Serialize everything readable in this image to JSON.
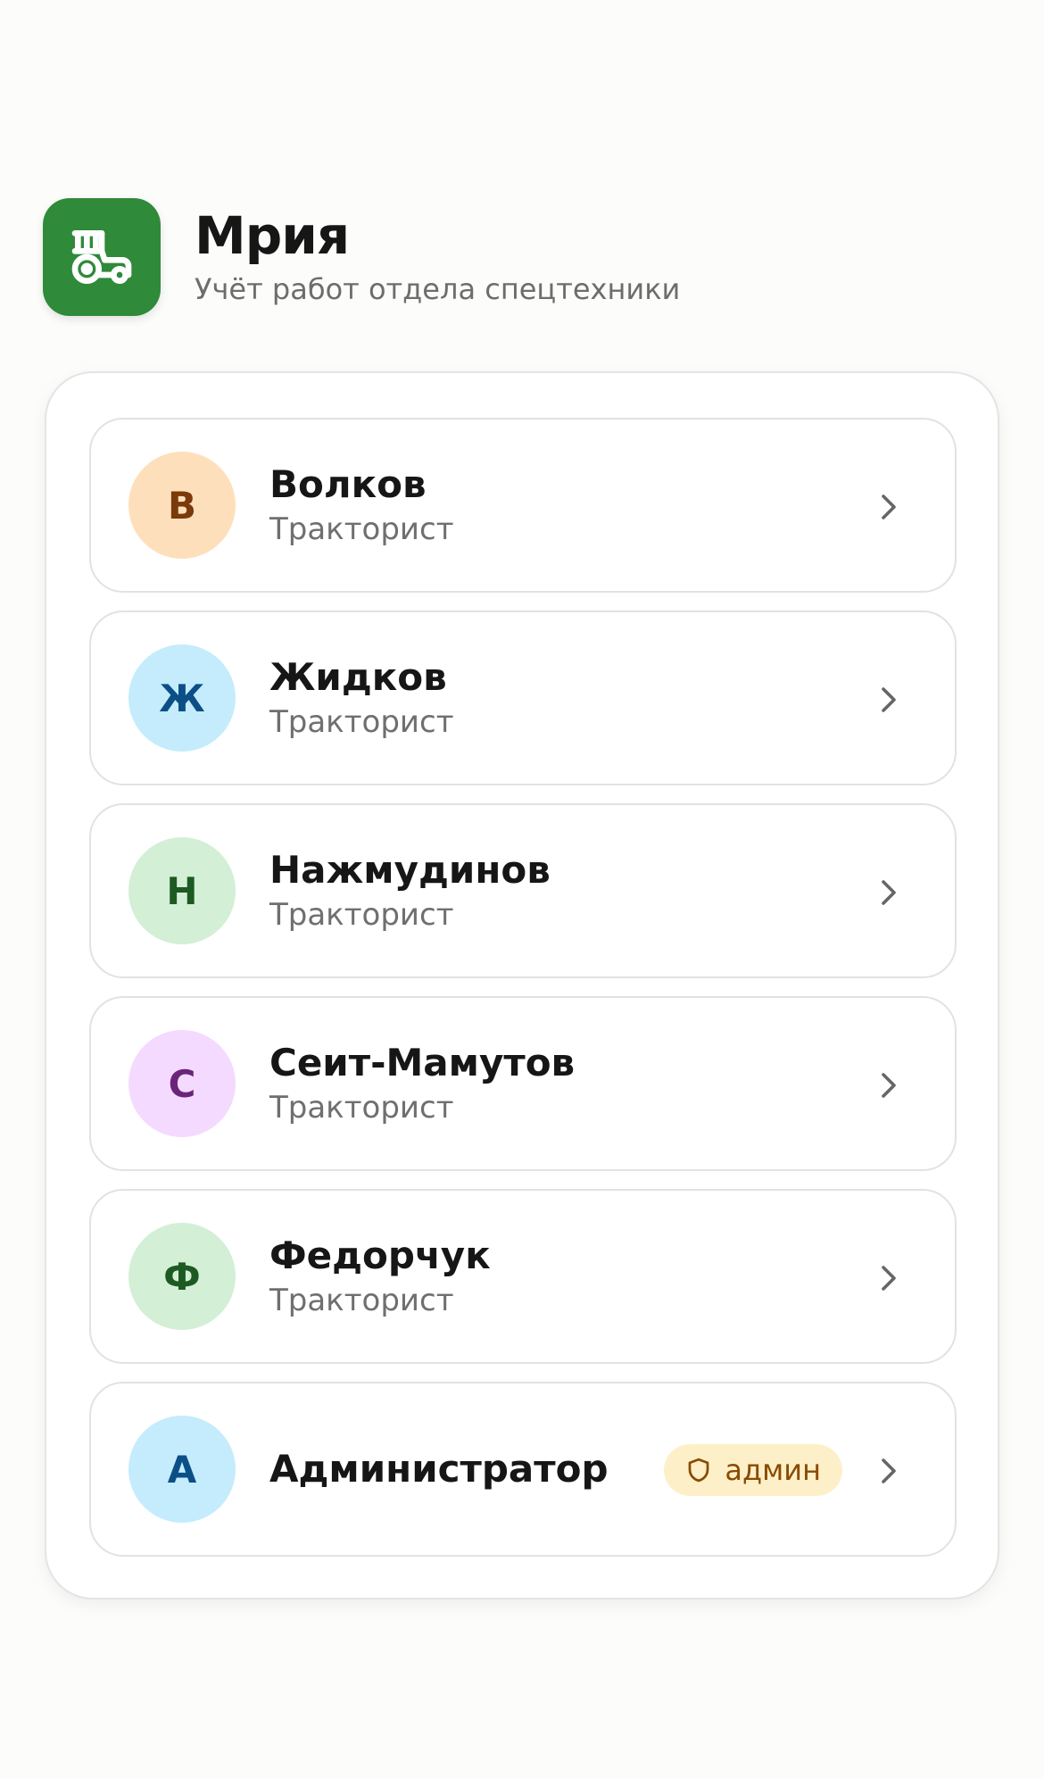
{
  "app": {
    "title": "Мрия",
    "subtitle": "Учёт работ отдела спецтехники",
    "logo_icon": "tractor-icon",
    "accent_color": "#2f8a3a"
  },
  "users": [
    {
      "initial": "В",
      "name": "Волков",
      "role": "Тракторист",
      "avatar_bg": "#fde0bb",
      "avatar_fg": "#7a3a0a"
    },
    {
      "initial": "Ж",
      "name": "Жидков",
      "role": "Тракторист",
      "avatar_bg": "#c4ecfd",
      "avatar_fg": "#0b4f86"
    },
    {
      "initial": "Н",
      "name": "Нажмудинов",
      "role": "Тракторист",
      "avatar_bg": "#d3efd6",
      "avatar_fg": "#1d5a22"
    },
    {
      "initial": "С",
      "name": "Сеит-Мамутов",
      "role": "Тракторист",
      "avatar_bg": "#f4dafe",
      "avatar_fg": "#6a2479"
    },
    {
      "initial": "Ф",
      "name": "Федорчук",
      "role": "Тракторист",
      "avatar_bg": "#d3efd6",
      "avatar_fg": "#1d5a22"
    },
    {
      "initial": "А",
      "name": "Администратор",
      "role": "",
      "avatar_bg": "#c4ecfd",
      "avatar_fg": "#0b4f86",
      "badge": "админ",
      "badge_icon": "shield-icon"
    }
  ],
  "icons": {
    "chevron": "chevron-right-icon"
  }
}
